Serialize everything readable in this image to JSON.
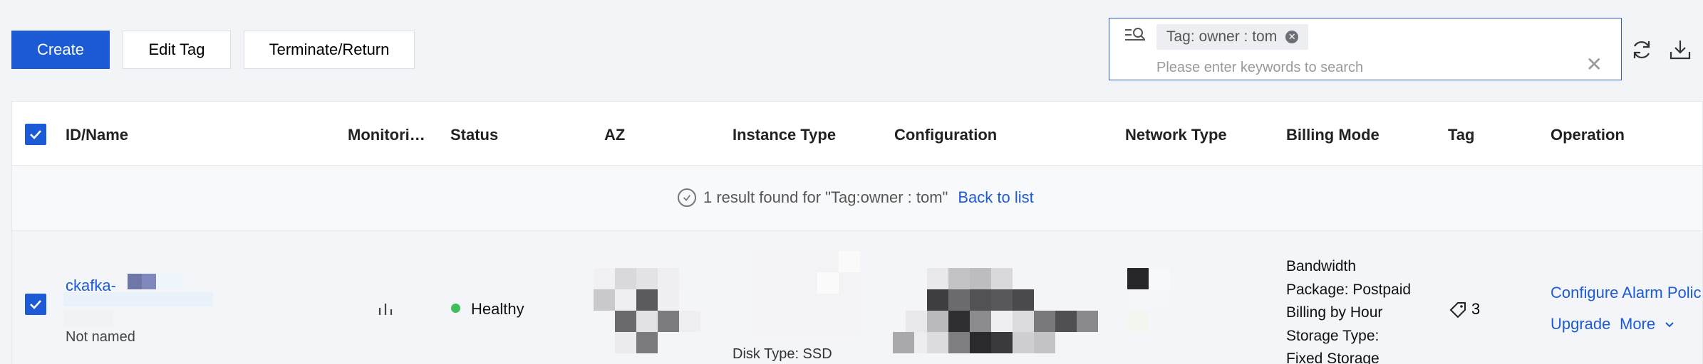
{
  "toolbar": {
    "create_label": "Create",
    "edit_tag_label": "Edit Tag",
    "terminate_label": "Terminate/Return"
  },
  "search": {
    "tag_chip": "Tag: owner : tom",
    "placeholder": "Please enter keywords to search"
  },
  "table": {
    "columns": [
      "ID/Name",
      "Monitori…",
      "Status",
      "AZ",
      "Instance Type",
      "Configuration",
      "Network Type",
      "Billing Mode",
      "Tag",
      "Operation"
    ],
    "result_message": "1 result found for \"Tag:owner : tom\"",
    "back_to_list": "Back to list",
    "rows": [
      {
        "id": "ckafka- ",
        "name": "Not named",
        "status": "Healthy",
        "disk_type_fragment": "Disk Type: SSD",
        "billing_lines": [
          "Bandwidth",
          "Package: Postpaid",
          "Billing by Hour",
          "Storage Type:",
          "Fixed Storage"
        ],
        "tag_count": "3",
        "operations": {
          "configure_alarm": "Configure Alarm Polic",
          "upgrade": "Upgrade",
          "more": "More"
        }
      }
    ]
  },
  "colors": {
    "primary": "#1d5bd6",
    "status_healthy": "#3fbf5a"
  }
}
